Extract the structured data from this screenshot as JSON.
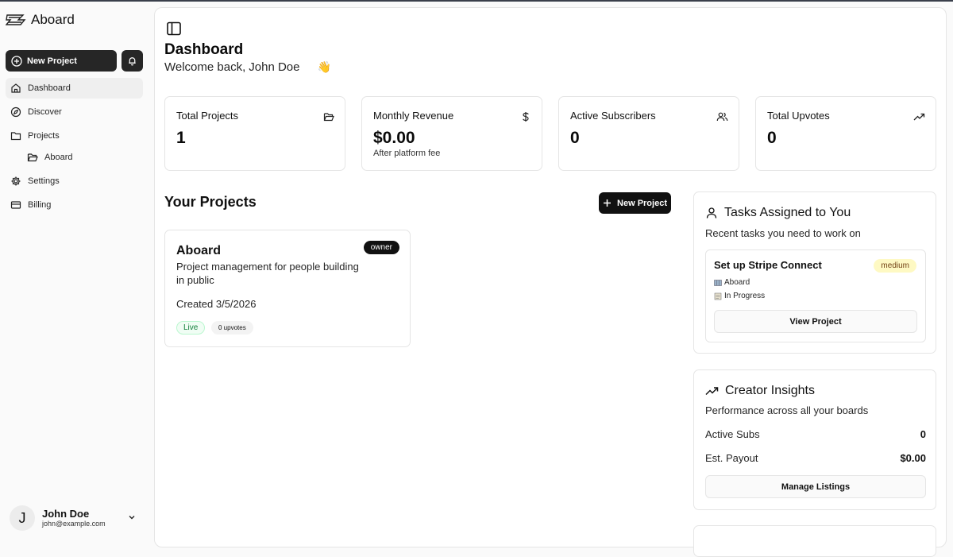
{
  "brand": {
    "name": "Aboard"
  },
  "sidebar": {
    "new_project_label": "New Project",
    "items": [
      {
        "label": "Dashboard",
        "icon": "home-icon"
      },
      {
        "label": "Discover",
        "icon": "compass-icon"
      },
      {
        "label": "Projects",
        "icon": "folder-icon"
      },
      {
        "label": "Aboard",
        "icon": "folder-open-icon"
      },
      {
        "label": "Settings",
        "icon": "gear-icon"
      },
      {
        "label": "Billing",
        "icon": "credit-card-icon"
      }
    ],
    "user": {
      "initial": "J",
      "name": "John Doe",
      "email": "john@example.com"
    }
  },
  "header": {
    "title": "Dashboard",
    "welcome_prefix": "Welcome back,",
    "user_name": "John Doe",
    "wave": "👋"
  },
  "stats": [
    {
      "label": "Total Projects",
      "value": "1",
      "sub": "",
      "icon": "folder-open-icon"
    },
    {
      "label": "Monthly Revenue",
      "value": "$0.00",
      "sub": "After platform fee",
      "icon": "dollar-icon"
    },
    {
      "label": "Active Subscribers",
      "value": "0",
      "sub": "",
      "icon": "users-icon"
    },
    {
      "label": "Total Upvotes",
      "value": "0",
      "sub": "",
      "icon": "trending-up-icon"
    }
  ],
  "projects": {
    "title": "Your Projects",
    "new_project_label": "New Project",
    "items": [
      {
        "name": "Aboard",
        "description": "Project management for people building in public",
        "role": "owner",
        "created": "Created 3/5/2026",
        "status": "Live",
        "upvotes": "0 upvotes"
      }
    ]
  },
  "tasks": {
    "title": "Tasks Assigned to You",
    "subtitle": "Recent tasks you need to work on",
    "items": [
      {
        "title": "Set up Stripe Connect",
        "priority": "medium",
        "project": "Aboard",
        "status": "In Progress",
        "action": "View Project"
      }
    ]
  },
  "insights": {
    "title": "Creator Insights",
    "subtitle": "Performance across all your boards",
    "rows": [
      {
        "label": "Active Subs",
        "value": "0"
      },
      {
        "label": "Est. Payout",
        "value": "$0.00"
      }
    ],
    "action": "Manage Listings"
  },
  "colors": {
    "accent": "#262626",
    "live": "#15803d",
    "priority_medium_bg": "#fef9c3"
  }
}
